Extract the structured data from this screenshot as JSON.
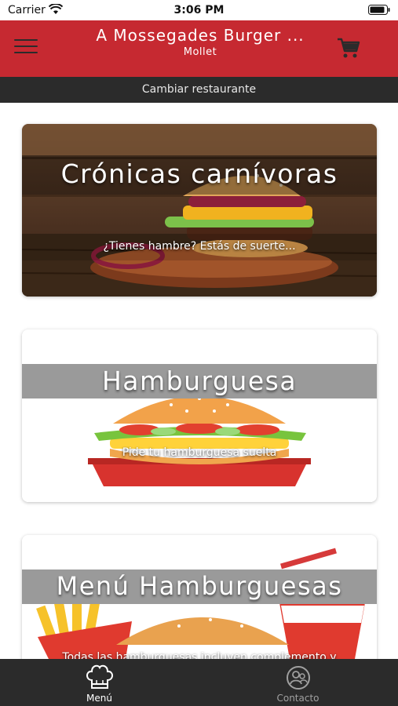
{
  "status_bar": {
    "carrier": "Carrier",
    "time": "3:06 PM"
  },
  "header": {
    "title": "A Mossegades Burger ...",
    "subtitle": "Mollet",
    "menu_icon": "hamburger-menu-icon",
    "cart_icon": "shopping-cart-icon",
    "color": "#c62931"
  },
  "change_restaurant": {
    "label": "Cambiar restaurante"
  },
  "cards": [
    {
      "title": "Crónicas carnívoras",
      "description": "¿Tienes hambre? Estás de suerte..."
    },
    {
      "title": "Hamburguesa",
      "description": "Pide tu hamburguesa suelta"
    },
    {
      "title": "Menú Hamburguesas",
      "description": "Todas las hamburguesas incluyen complemento y"
    }
  ],
  "tabbar": {
    "items": [
      {
        "label": "Menú",
        "icon": "chef-hat-icon",
        "active": true
      },
      {
        "label": "Contacto",
        "icon": "contact-person-icon",
        "active": false
      }
    ],
    "active_color": "#ffffff",
    "inactive_color": "#a0a0a0"
  }
}
